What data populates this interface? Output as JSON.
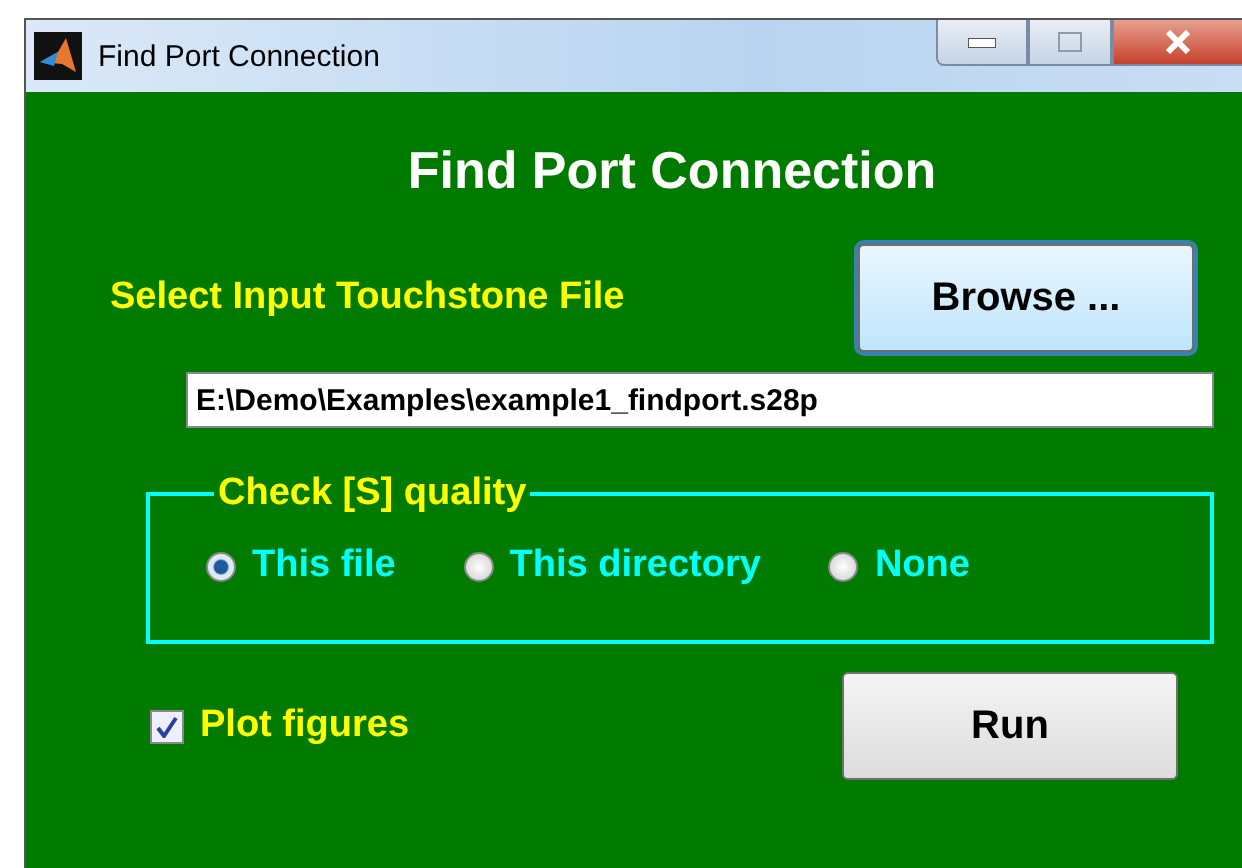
{
  "window": {
    "title": "Find Port Connection"
  },
  "heading": "Find Port Connection",
  "file_label": "Select Input Touchstone File",
  "browse_button": "Browse ...",
  "file_path": "E:\\Demo\\Examples\\example1_findport.s28p",
  "quality_group": {
    "legend": "Check [S] quality",
    "options": [
      {
        "label": "This file",
        "selected": true
      },
      {
        "label": "This directory",
        "selected": false
      },
      {
        "label": "None",
        "selected": false
      }
    ]
  },
  "plot_figures": {
    "label": "Plot figures",
    "checked": true
  },
  "run_button": "Run"
}
